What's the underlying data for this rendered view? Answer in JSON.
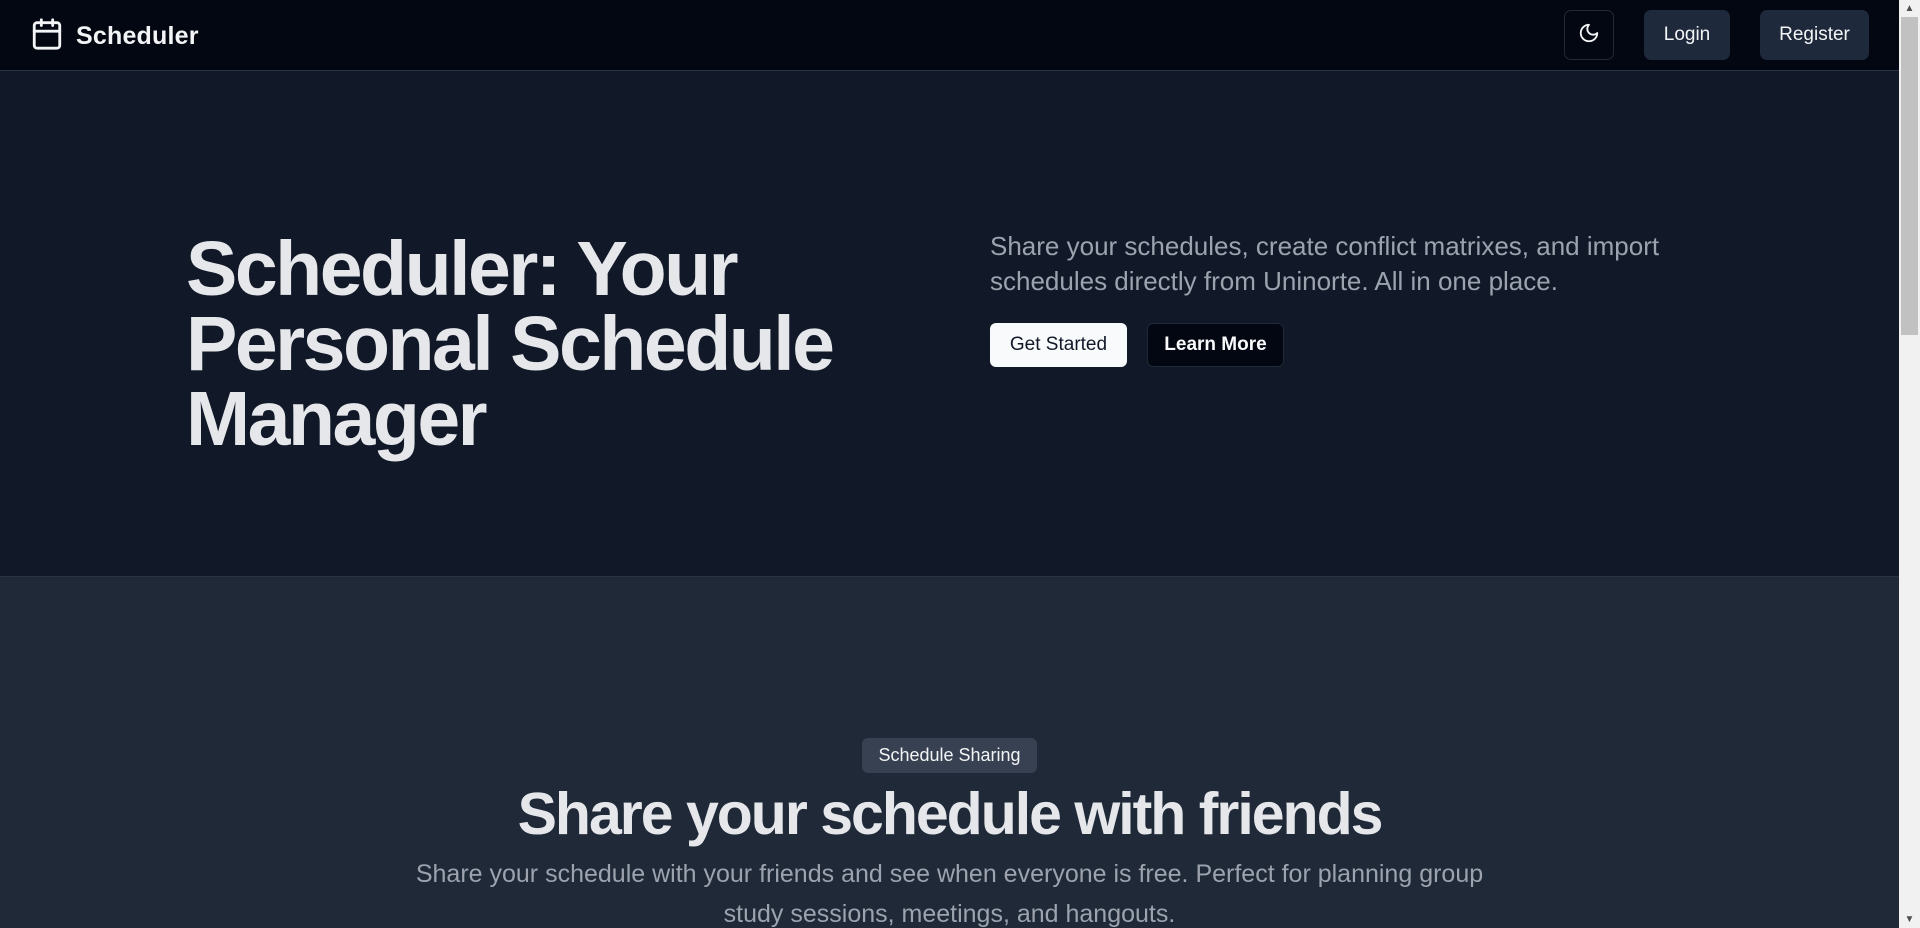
{
  "header": {
    "brand": "Scheduler",
    "theme_icon": "moon-icon",
    "login_label": "Login",
    "register_label": "Register"
  },
  "hero": {
    "title": "Scheduler: Your Personal Schedule Manager",
    "description": "Share your schedules, create conflict matrixes, and import schedules directly from Uninorte. All in one place.",
    "get_started_label": "Get Started",
    "learn_more_label": "Learn More"
  },
  "features": {
    "badge": "Schedule Sharing",
    "title": "Share your schedule with friends",
    "description": "Share your schedule with your friends and see when everyone is free. Perfect for planning group study sessions, meetings, and hangouts."
  },
  "icons": {
    "brand": "calendar-icon",
    "theme": "moon-icon"
  },
  "colors": {
    "header_bg": "#030712",
    "hero_bg": "#111827",
    "features_bg": "#1f2937",
    "text_primary": "#e5e7eb",
    "text_muted": "#9ca3af"
  }
}
